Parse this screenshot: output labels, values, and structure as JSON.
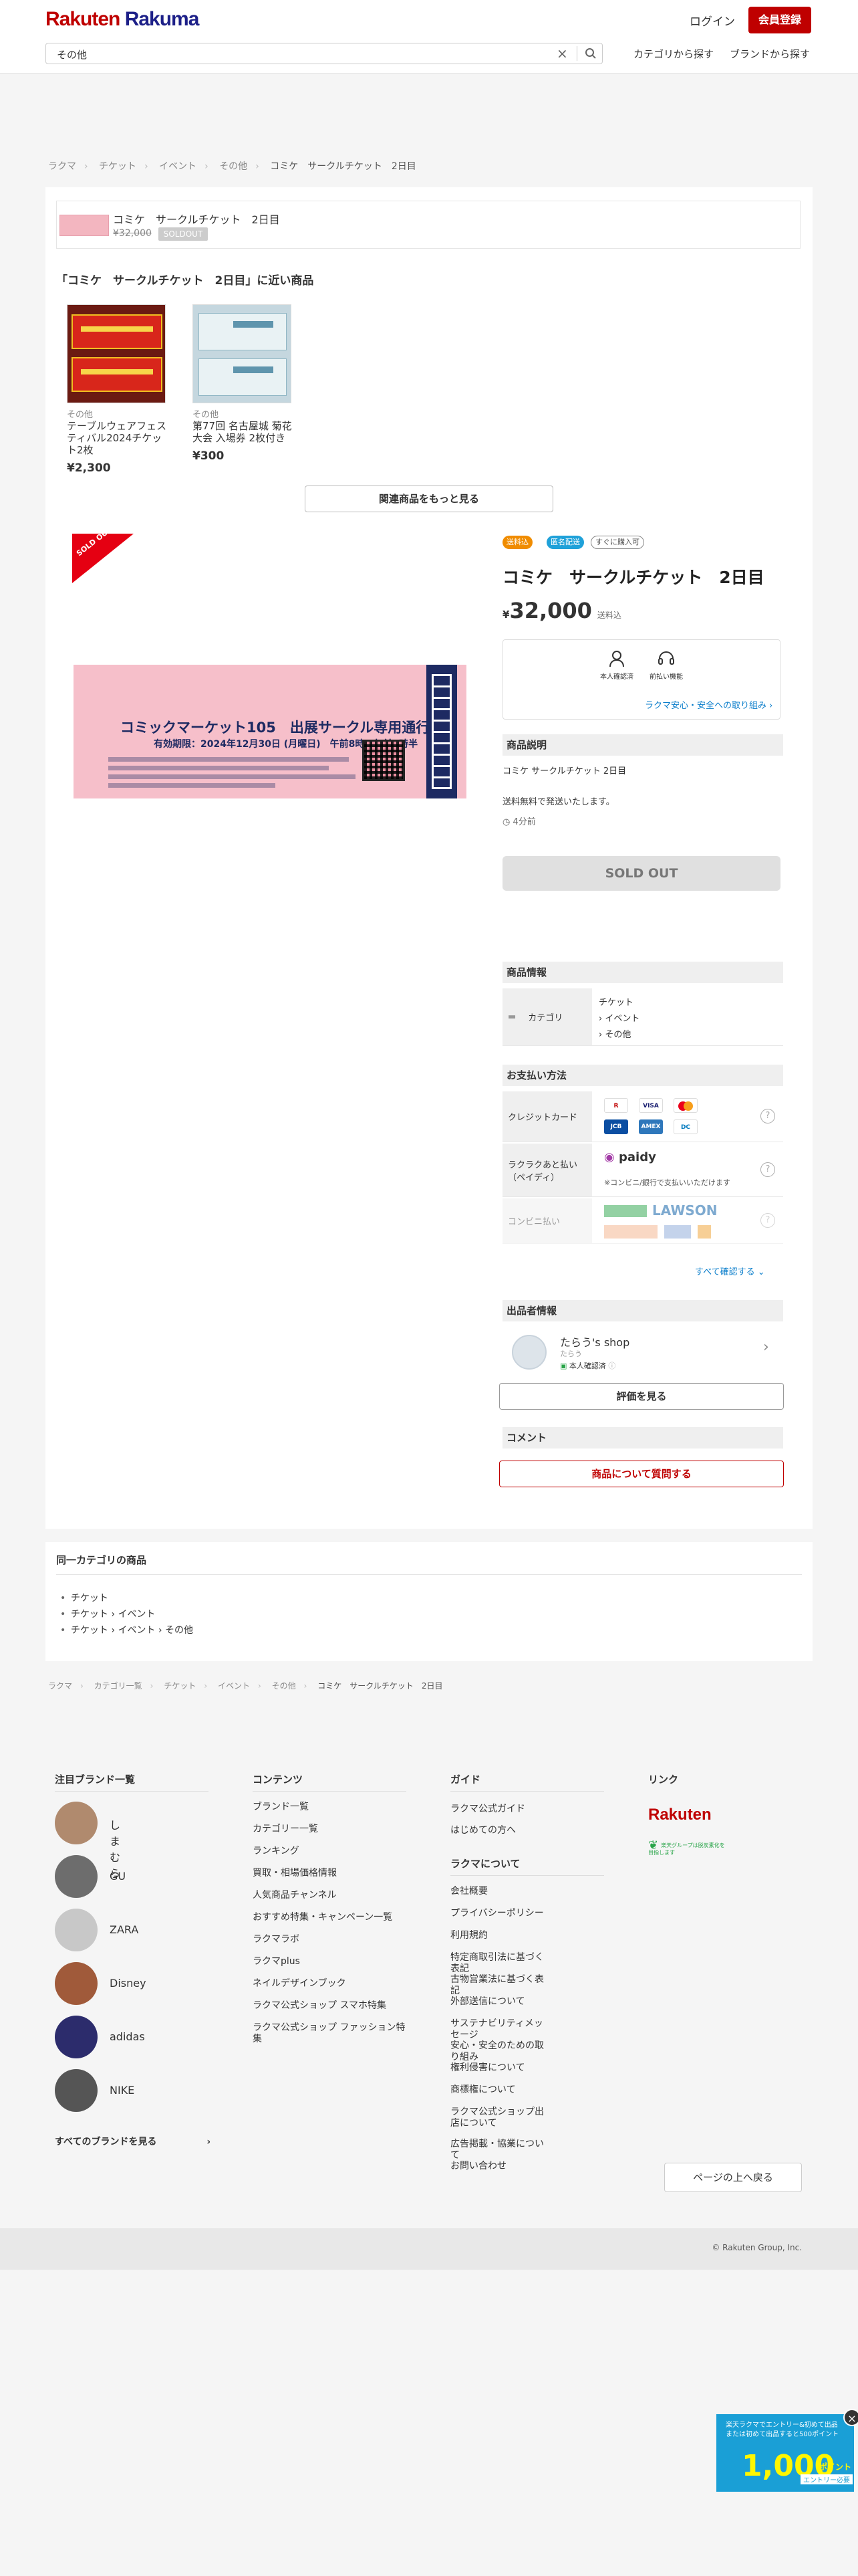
{
  "header": {
    "logo_a": "Rakuten",
    "logo_b": " Rakuma",
    "login": "ログイン",
    "signup": "会員登録",
    "search_value": "その他",
    "nav_category": "カテゴリから探す",
    "nav_brand": "ブランドから探す"
  },
  "breadcrumb_top": [
    "ラクマ",
    "チケット",
    "イベント",
    "その他",
    "コミケ　サークルチケット　2日目"
  ],
  "summary": {
    "title": "コミケ　サークルチケット　2日目",
    "old_price": "¥32,000",
    "sold_label": "SOLDOUT"
  },
  "similar": {
    "heading": "「コミケ　サークルチケット　2日目」に近い商品",
    "items": [
      {
        "category": "その他",
        "name": "テーブルウェアフェスティバル2024チケット2枚",
        "price": "¥2,300"
      },
      {
        "category": "その他",
        "name": "第77回 名古屋城 菊花大会 入場券 2枚付き",
        "price": "¥300"
      }
    ],
    "more_button": "関連商品をもっと見る"
  },
  "item": {
    "ribbon": "SOLD OUT",
    "ticket_title": "コミックマーケット105　出展サークル専用通行証",
    "ticket_date": "有効期限：2024年12月30日 (月曜日)　午前8時〜午前9時半",
    "badges": [
      "送料込",
      "匿名配送",
      "すぐに購入可"
    ],
    "title": "コミケ　サークルチケット　2日目",
    "price_yen": "¥",
    "price": "32,000",
    "shipping_note": "送料込",
    "safe_icons": [
      "本人確認済",
      "前払い機能"
    ],
    "safe_link": "ラクマ安心・安全への取り組み",
    "desc_heading": "商品説明",
    "desc_title": "コミケ サークルチケット 2日目",
    "desc_body": "送料無料で発送いたします。",
    "posted": "4分前",
    "sold_button": "SOLD OUT"
  },
  "product_info": {
    "heading": "商品情報",
    "category_label": "カテゴリ",
    "categories": [
      "チケット",
      "› イベント",
      "› その他"
    ]
  },
  "payment": {
    "heading": "お支払い方法",
    "rows": [
      {
        "label": "クレジットカード"
      },
      {
        "label": "ラクラクあと払い（ペイディ）",
        "note": "※コンビニ/銀行で支払いいただけます",
        "brand": "paidy"
      },
      {
        "label": "コンビニ払い",
        "brand": "LAWSON"
      }
    ],
    "cards": [
      "Rakuten Card",
      "VISA",
      "MC",
      "JCB",
      "AMEX",
      "Diners"
    ],
    "see_all": "すべて確認する"
  },
  "seller": {
    "heading": "出品者情報",
    "name": "たらう's shop",
    "sub": "たらう",
    "verified": "本人確認済",
    "reviews_button": "評価を見る"
  },
  "comment": {
    "heading": "コメント",
    "ask_button": "商品について質問する"
  },
  "same_category": {
    "heading": "同一カテゴリの商品",
    "items": [
      "チケット",
      "チケット › イベント",
      "チケット › イベント › その他"
    ]
  },
  "breadcrumb_bottom": [
    "ラクマ",
    "カテゴリ一覧",
    "チケット",
    "イベント",
    "その他",
    "コミケ　サークルチケット　2日目"
  ],
  "footer": {
    "brands_heading": "注目ブランド一覧",
    "brands": [
      "しまむら",
      "GU",
      "ZARA",
      "Disney",
      "adidas",
      "NIKE"
    ],
    "brands_all": "すべてのブランドを見る",
    "contents_heading": "コンテンツ",
    "contents": [
      "ブランド一覧",
      "カテゴリー一覧",
      "ランキング",
      "買取・相場価格情報",
      "人気商品チャンネル",
      "おすすめ特集・キャンペーン一覧",
      "ラクマラボ",
      "ラクマplus",
      "ネイルデザインブック",
      "ラクマ公式ショップ スマホ特集",
      "ラクマ公式ショップ ファッション特集"
    ],
    "guide_heading": "ガイド",
    "guide": [
      "ラクマ公式ガイド",
      "はじめての方へ"
    ],
    "about_heading": "ラクマについて",
    "about": [
      "会社概要",
      "プライバシーポリシー",
      "利用規約",
      "特定商取引法に基づく表記",
      "古物営業法に基づく表記",
      "外部送信について",
      "サステナビリティメッセージ",
      "安心・安全のための取り組み",
      "権利侵害について",
      "商標権について",
      "ラクマ公式ショップ出店について",
      "広告掲載・協業について",
      "お問い合わせ"
    ],
    "links_heading": "リンク",
    "rakuten_logo": "Rakuten",
    "eco_label": "楽天グループは脱炭素化を目指します",
    "top_button": "ページの上へ戻る",
    "copyright": "© Rakuten Group, Inc."
  },
  "promo": {
    "line1": "楽天ラクマでエントリー&初めて出品",
    "line2": "または初めて出品すると500ポイント",
    "amount": "1,000",
    "unit": "ポイント",
    "entry": "エントリー必要"
  }
}
